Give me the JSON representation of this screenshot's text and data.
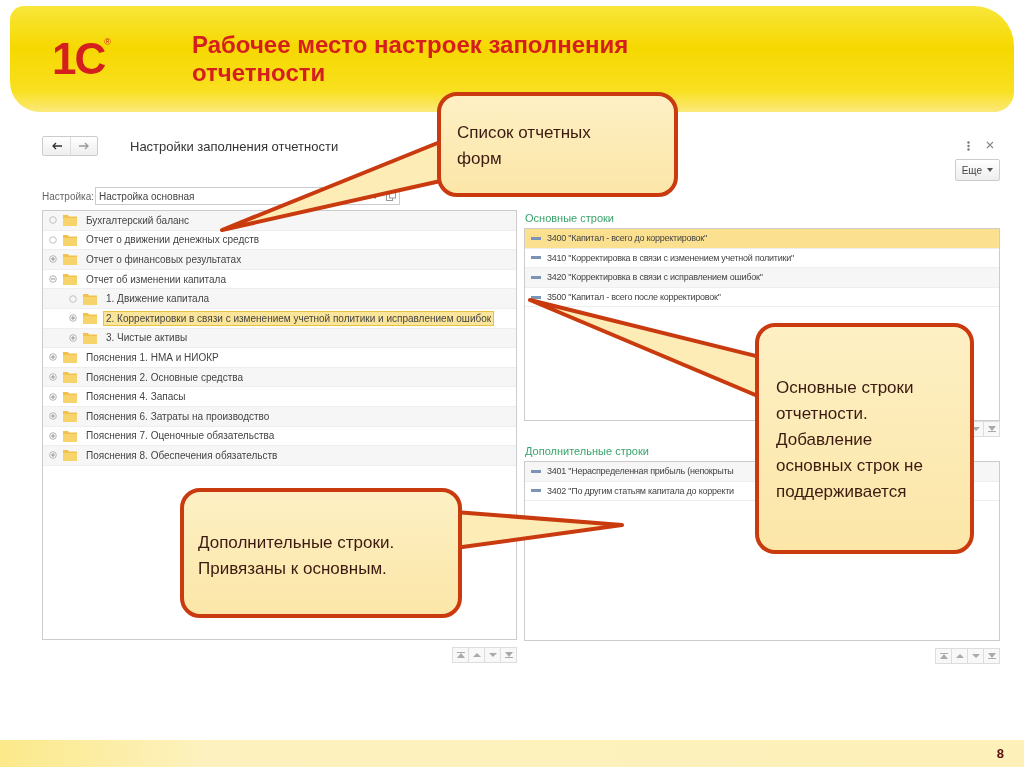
{
  "logo": {
    "text": "1С",
    "mark": "®"
  },
  "title": "Рабочее место настроек заполнения отчетности",
  "window": {
    "title": "Настройки заполнения отчетности",
    "more_button": "Еще",
    "setting": {
      "label": "Настройка:",
      "value": "Настройка основная"
    },
    "tree": [
      {
        "text": "Бухгалтерский баланс",
        "kind": "leaf",
        "selected": false
      },
      {
        "text": "Отчет о движении денежных средств",
        "kind": "leaf",
        "selected": false
      },
      {
        "text": "Отчет о финансовых результатах",
        "kind": "group",
        "expanded": false,
        "selected": false
      },
      {
        "text": "Отчет об изменении капитала",
        "kind": "group",
        "expanded": true,
        "selected": false,
        "children": [
          {
            "text": "1. Движение капитала",
            "kind": "leaf",
            "selected": false
          },
          {
            "text": "2. Корректировки в связи с изменением учетной политики и исправлением ошибок",
            "kind": "group",
            "expanded": false,
            "selected": true
          },
          {
            "text": "3. Чистые активы",
            "kind": "group",
            "expanded": false,
            "selected": false
          }
        ]
      },
      {
        "text": "Пояснения 1. НМА и НИОКР",
        "kind": "group",
        "expanded": false,
        "selected": false
      },
      {
        "text": "Пояснения 2. Основные средства",
        "kind": "group",
        "expanded": false,
        "selected": false
      },
      {
        "text": "Пояснения 4. Запасы",
        "kind": "group",
        "expanded": false,
        "selected": false
      },
      {
        "text": "Пояснения 6. Затраты на производство",
        "kind": "group",
        "expanded": false,
        "selected": false
      },
      {
        "text": "Пояснения 7. Оценочные обязательства",
        "kind": "group",
        "expanded": false,
        "selected": false
      },
      {
        "text": "Пояснения 8. Обеспечения обязательств",
        "kind": "group",
        "expanded": false,
        "selected": false
      }
    ],
    "main_rows": {
      "heading": "Основные строки",
      "rows": [
        {
          "text": "3400 \"Капитал - всего до корректировок\"",
          "selected": true
        },
        {
          "text": "3410 \"Корректировка в связи с изменением учетной политики\"",
          "selected": false
        },
        {
          "text": "3420 \"Корректировка в связи с исправлением ошибок\"",
          "selected": false
        },
        {
          "text": "3500 \"Капитал - всего после корректировок\"",
          "selected": false
        }
      ]
    },
    "additional_rows": {
      "heading": "Дополнительные строки",
      "rows": [
        {
          "text": "3401 \"Нераспределенная прибыль (непокрыты",
          "selected": false
        },
        {
          "text": "3402 \"По другим статьям капитала до корректи",
          "selected": false
        }
      ]
    }
  },
  "callouts": [
    {
      "text": "Список отчетных форм"
    },
    {
      "text": "Основные строки отчетности. Добавление основных строк не поддерживается"
    },
    {
      "text": "Дополнительные строки. Привязаны к основным."
    }
  ],
  "page_number": "8"
}
